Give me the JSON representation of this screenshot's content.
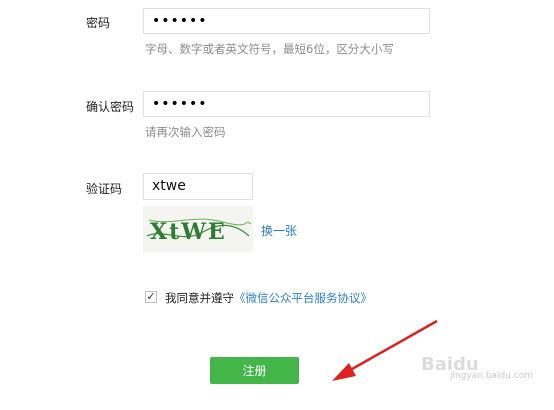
{
  "form": {
    "password": {
      "label": "密码",
      "value": "••••••",
      "hint": "字母、数字或者英文符号，最短6位，区分大小写"
    },
    "confirm": {
      "label": "确认密码",
      "value": "••••••",
      "hint": "请再次输入密码"
    },
    "captcha": {
      "label": "验证码",
      "value": "xtwe",
      "image_text": "XtWE",
      "refresh_label": "换一张"
    },
    "agreement": {
      "prefix": "我同意并遵守",
      "link": "《微信公众平台服务协议》",
      "checked_mark": "✓"
    },
    "submit_label": "注册"
  },
  "watermark": {
    "logo": "Baidu",
    "sub": "jingyan.baidu.com"
  },
  "colors": {
    "accent_green": "#44b549",
    "link_blue": "#2a7fd4",
    "arrow_red": "#e02020"
  }
}
